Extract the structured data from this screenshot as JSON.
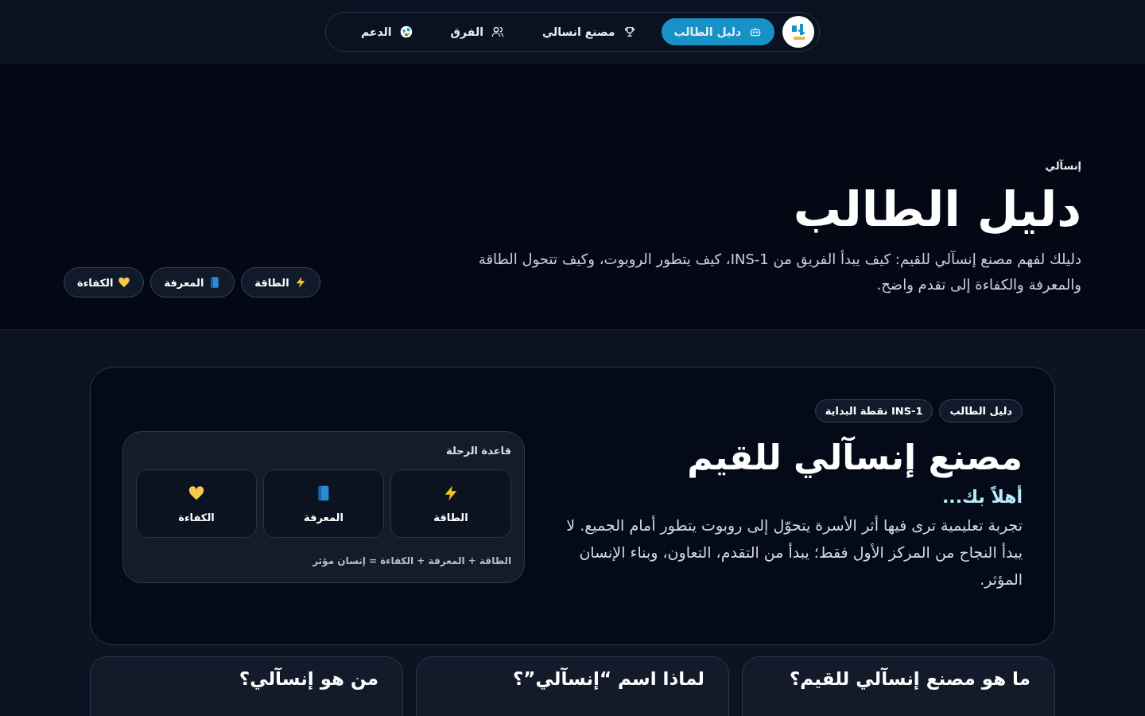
{
  "nav": {
    "items": [
      {
        "label": "دليل الطالب",
        "selected": true
      },
      {
        "label": "مصنع انسالي",
        "selected": false
      },
      {
        "label": "الفرق",
        "selected": false
      },
      {
        "label": "الدعم",
        "selected": false
      }
    ]
  },
  "hero": {
    "eyebrow": "إنسآلي",
    "title": "دليل الطالب",
    "description": "دليلك لفهم مصنع إنسآلي للقيم: كيف يبدأ الفريق من INS-1، كيف يتطور الروبوت، وكيف تتحول الطاقة والمعرفة والكفاءة إلى تقدم واضح.",
    "chips": [
      {
        "label": "الطاقة"
      },
      {
        "label": "المعرفة"
      },
      {
        "label": "الكفاءة"
      }
    ]
  },
  "intro": {
    "tags": [
      "دليل الطالب",
      "INS-1 نقطة البداية"
    ],
    "title": "مصنع إنسآلي للقيم",
    "subtitle": "أهلاً بك...",
    "paragraph": "تجربة تعليمية ترى فيها أثر الأسرة يتحوّل إلى روبوت يتطور أمام الجميع. لا يبدأ النجاح من المركز الأول فقط؛ يبدأ من التقدم، التعاون، وبناء الإنسان المؤثر.",
    "journey": {
      "title": "قاعدة الرحلة",
      "items": [
        {
          "label": "الطاقة"
        },
        {
          "label": "المعرفة"
        },
        {
          "label": "الكفاءة"
        }
      ],
      "formula": "الطاقة + المعرفة + الكفاءة = إنسان مؤثر"
    }
  },
  "faq_cards": [
    {
      "title": "ما هو مصنع إنسآلي للقيم؟"
    },
    {
      "title": "لماذا اسم “إنسآلي”؟"
    },
    {
      "title": "من هو إنسآلي؟"
    }
  ]
}
